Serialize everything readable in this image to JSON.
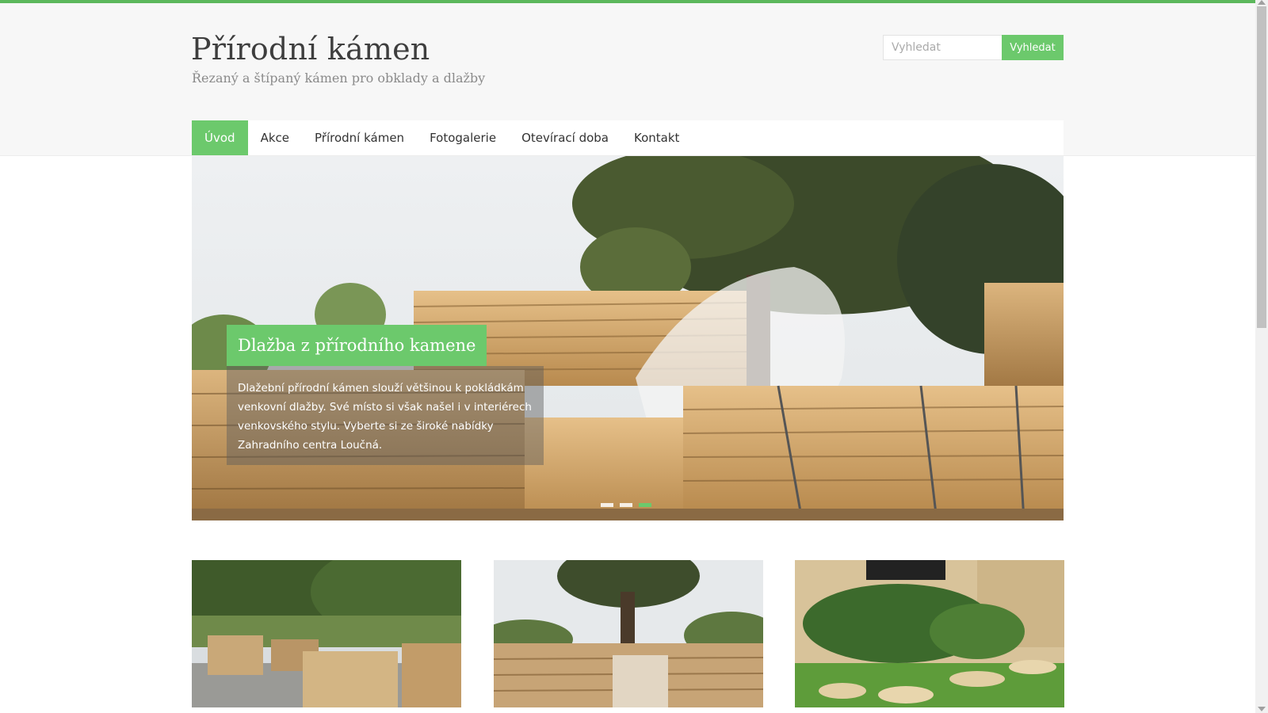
{
  "site": {
    "title": "Přírodní kámen",
    "subtitle": "Řezaný a štípaný kámen pro obklady a dlažby"
  },
  "search": {
    "placeholder": "Vyhledat",
    "button_label": "Vyhledat"
  },
  "nav": {
    "items": [
      {
        "label": "Úvod",
        "active": true
      },
      {
        "label": "Akce",
        "active": false
      },
      {
        "label": "Přírodní kámen",
        "active": false
      },
      {
        "label": "Fotogalerie",
        "active": false
      },
      {
        "label": "Otevírací doba",
        "active": false
      },
      {
        "label": "Kontakt",
        "active": false
      }
    ]
  },
  "slider": {
    "title": "Dlažba z přírodního kamene",
    "text": "Dlažební přírodní kámen slouží většinou k pokládkám venkovní dlažby. Své místo si však našel i v interiérech venkovského stylu. Vyberte si ze široké nabídky Zahradního centra Loučná.",
    "slide_count": 3,
    "active_slide": 3
  },
  "colors": {
    "accent": "#6cc96c",
    "top_bar": "#5cb85c",
    "header_bg": "#f7f7f7"
  }
}
